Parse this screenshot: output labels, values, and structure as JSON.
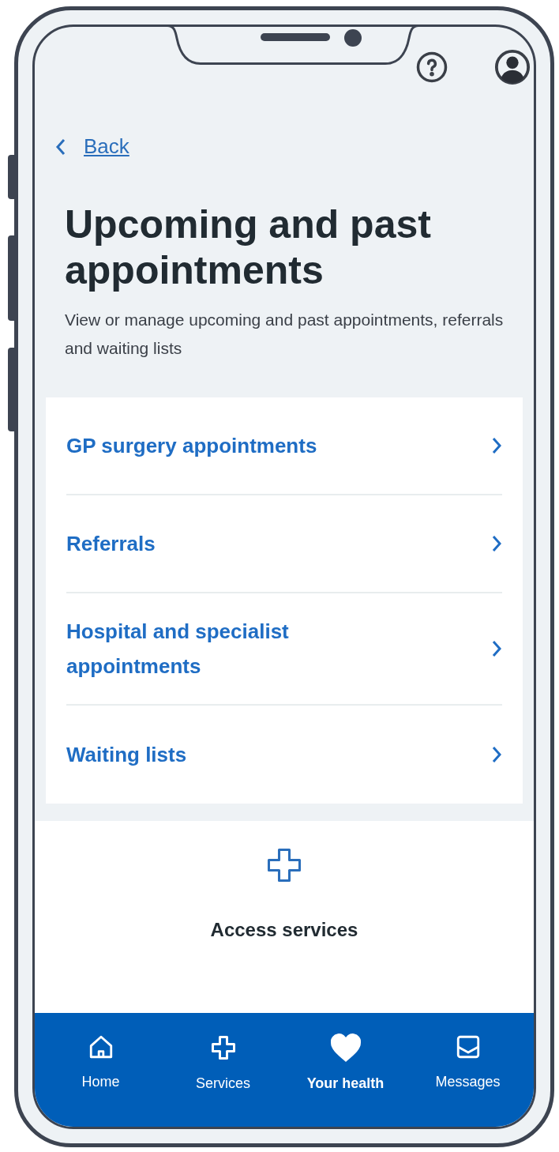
{
  "header": {
    "back": {
      "label": "Back"
    }
  },
  "page": {
    "title": "Upcoming and past appointments",
    "subtitle": "View or manage upcoming and past appointments, referrals and waiting lists"
  },
  "menu": [
    {
      "label": "GP surgery appointments"
    },
    {
      "label": "Referrals"
    },
    {
      "label": "Hospital and specialist appointments"
    },
    {
      "label": "Waiting lists"
    }
  ],
  "promo": {
    "title": "Access services"
  },
  "nav": [
    {
      "kind": "home",
      "label": "Home",
      "selected": false
    },
    {
      "kind": "services",
      "label": "Services",
      "selected": false
    },
    {
      "kind": "health",
      "label": "Your health",
      "selected": true
    },
    {
      "kind": "messages",
      "label": "Messages",
      "selected": false
    }
  ]
}
